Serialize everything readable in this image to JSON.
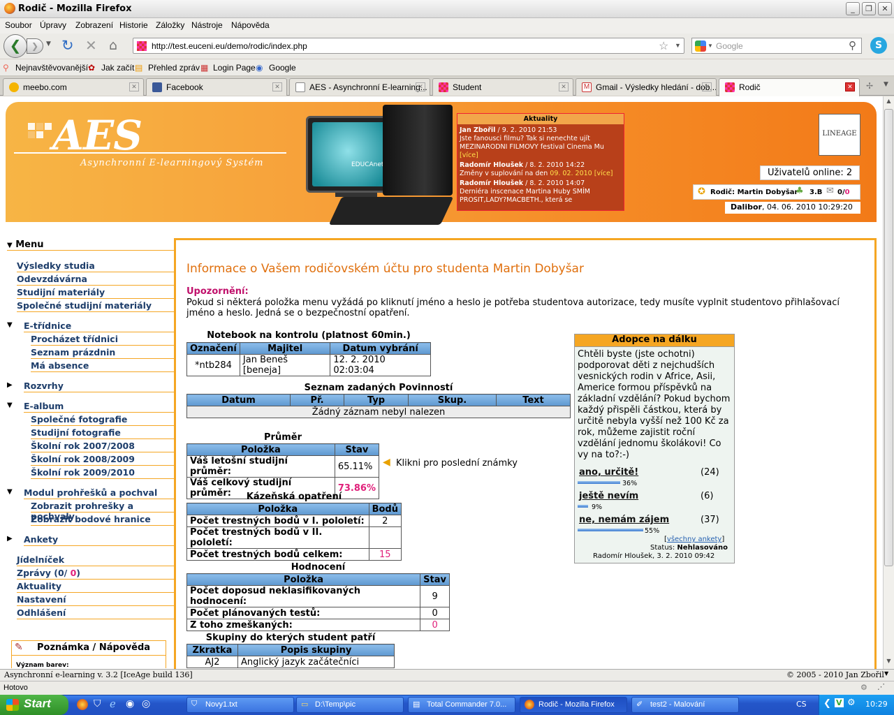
{
  "window": {
    "title": "Rodič - Mozilla Firefox"
  },
  "menu": [
    "Soubor",
    "Úpravy",
    "Zobrazení",
    "Historie",
    "Záložky",
    "Nástroje",
    "Nápověda"
  ],
  "url": "http://test.euceni.eu/demo/rodic/index.php",
  "search_placeholder": "Google",
  "bookmarks": [
    "Nejnavštěvovanější",
    "Jak začít",
    "Přehled zpráv",
    "Login Page",
    "Google"
  ],
  "tabs": [
    "meebo.com",
    "Facebook",
    "AES - Asynchronní E-learning...",
    "Student",
    "Gmail - Výsledky hledání - dob...",
    "Rodič"
  ],
  "header": {
    "logo": "AES",
    "logo_sub": "Asynchronní E-learningový Systém",
    "monitor_text": "EDUCAnet Brno",
    "news_title": "Aktuality",
    "news": [
      {
        "author": "Jan Zbořil",
        "date": "/ 9. 2. 2010 21:53",
        "text": "Jste fanousci filmu? Tak si nenechte ujít MEZINARODNI FILMOVY festival Cinema Mu",
        "more": "[více]"
      },
      {
        "author": "Radomír Hloušek",
        "date": "/ 8. 2. 2010 14:22",
        "text": "Změny v suplování na den",
        "hl": "09. 02. 2010",
        "more": "[více]"
      },
      {
        "author": "Radomír Hloušek",
        "date": "/ 8. 2. 2010 14:07",
        "text": "Derniéra inscenace Martina Huby SMÍM PROSIT,LADY?MACBETH., která se"
      }
    ],
    "badge": "LINEAGE",
    "online_label": "Uživatelů online:",
    "online_count": "2",
    "parent_label": "Rodič: Martin Dobyšar",
    "class": "3.B",
    "msgs_read": "0/",
    "msgs_new": "0",
    "user": "Dalibor",
    "datetime": ", 04. 06. 2010 10:29:20"
  },
  "sidebar": {
    "title": "Menu",
    "items": [
      "Výsledky studia",
      "Odevzdávárna",
      "Studijní materiály",
      "Společné studijní materiály"
    ],
    "etridnice": "E-třídnice",
    "etridnice_items": [
      "Procházet třídnici",
      "Seznam prázdnin",
      "Má absence"
    ],
    "rozvrhy": "Rozvrhy",
    "ealbum": "E-album",
    "ealbum_items": [
      "Společné fotografie",
      "Studijní fotografie",
      "Školní rok 2007/2008",
      "Školní rok 2008/2009",
      "Školní rok 2009/2010"
    ],
    "modul": "Modul prohřešků a pochval",
    "modul_items": [
      "Zobrazit prohrešky a pochvaly",
      "Zobrazit bodové hranice"
    ],
    "ankety": "Ankety",
    "bottom": [
      "Jídelníček",
      "Zprávy (0/ ",
      "Aktuality",
      "Nastavení",
      "Odhlášení"
    ],
    "zpravy_new": "0",
    "zpravy_close": ")",
    "note_title": "Poznámka / Nápověda",
    "note_text": "Význam barev:"
  },
  "main": {
    "title": "Informace o Vašem rodičovském účtu pro studenta Martin Dobyšar",
    "warn_title": "Upozornění:",
    "warn_text": "Pokud si některá položka menu vyžádá po kliknutí jméno a heslo je potřeba studentova autorizace, tedy musíte vyplnit studentovo přihlašovací jméno a heslo. Jedná se o bezpečnostní opatření.",
    "notebook": {
      "caption": "Notebook na kontrolu (platnost 60min.)",
      "headers": [
        "Označení",
        "Majitel",
        "Datum vybrání"
      ],
      "row": [
        "*ntb284",
        "Jan Beneš [beneja]",
        "12. 2. 2010 02:03:04"
      ]
    },
    "povinnosti": {
      "caption": "Seznam zadaných Povinností",
      "headers": [
        "Datum",
        "Př.",
        "Typ",
        "Skup.",
        "Text"
      ],
      "empty": "Žádný záznam nebyl nalezen"
    },
    "prumer": {
      "caption": "Průměr",
      "headers": [
        "Položka",
        "Stav"
      ],
      "rows": [
        [
          "Váš letošní studijní průměr:",
          "65.11%"
        ],
        [
          "Váš celkový studijní průměr:",
          "73.86%"
        ]
      ],
      "hint": "Klikni pro poslední známky"
    },
    "kazen": {
      "caption": "Kázeňská opatření",
      "headers": [
        "Položka",
        "Bodů"
      ],
      "rows": [
        [
          "Počet trestných bodů v I. pololetí:",
          "2"
        ],
        [
          "Počet trestných bodů v II. pololetí:",
          ""
        ],
        [
          "Počet trestných bodů celkem:",
          "15"
        ]
      ]
    },
    "hodnoceni": {
      "caption": "Hodnocení",
      "headers": [
        "Položka",
        "Stav"
      ],
      "rows": [
        [
          "Počet doposud neklasifikovaných hodnocení:",
          "9"
        ],
        [
          "Počet plánovaných testů:",
          "0"
        ],
        [
          "Z toho zmeškaných:",
          "0"
        ]
      ]
    },
    "skupiny": {
      "caption": "Skupiny do kterých student patří",
      "headers": [
        "Zkratka",
        "Popis skupiny"
      ],
      "row": [
        "AJ2",
        "Anglický jazyk začátečníci"
      ]
    }
  },
  "adopce": {
    "title": "Adopce na dálku",
    "text": "Chtěli byste (jste ochotni) podporovat děti z nejchudších vesnických rodin v Africe, Asii, Americe formou příspěvků na základní vzdělání? Pokud bychom každý přispěli částkou, která by určitě nebyla vyšší než 100 Kč za rok, můžeme zajistit roční vzdělání jednomu školákovi! Co vy na to?:-)",
    "options": [
      {
        "label": "ano, určitě!",
        "count": "(24)",
        "pct": "36%",
        "value": 36
      },
      {
        "label": "ještě nevím",
        "count": "(6)",
        "pct": "9%",
        "value": 9
      },
      {
        "label": "ne, nemám zájem",
        "count": "(37)",
        "pct": "55%",
        "value": 55
      }
    ],
    "all_link": "všechny ankety",
    "status_label": "Status:",
    "status": "Nehlasováno",
    "author": "Radomír Hloušek, 3. 2. 2010 09:42"
  },
  "footer": {
    "left": "Asynchronní e-learning  v. 3.2 [IceAge build 136]",
    "right": "© 2005 - 2010  Jan Zbořil"
  },
  "status": "Hotovo",
  "taskbar": {
    "start": "Start",
    "items": [
      "Novy1.txt",
      "D:\\Temp\\pic",
      "Total Commander 7.0...",
      "Rodič - Mozilla Firefox",
      "test2 - Malování"
    ],
    "lang": "CS",
    "clock": "10:29"
  }
}
